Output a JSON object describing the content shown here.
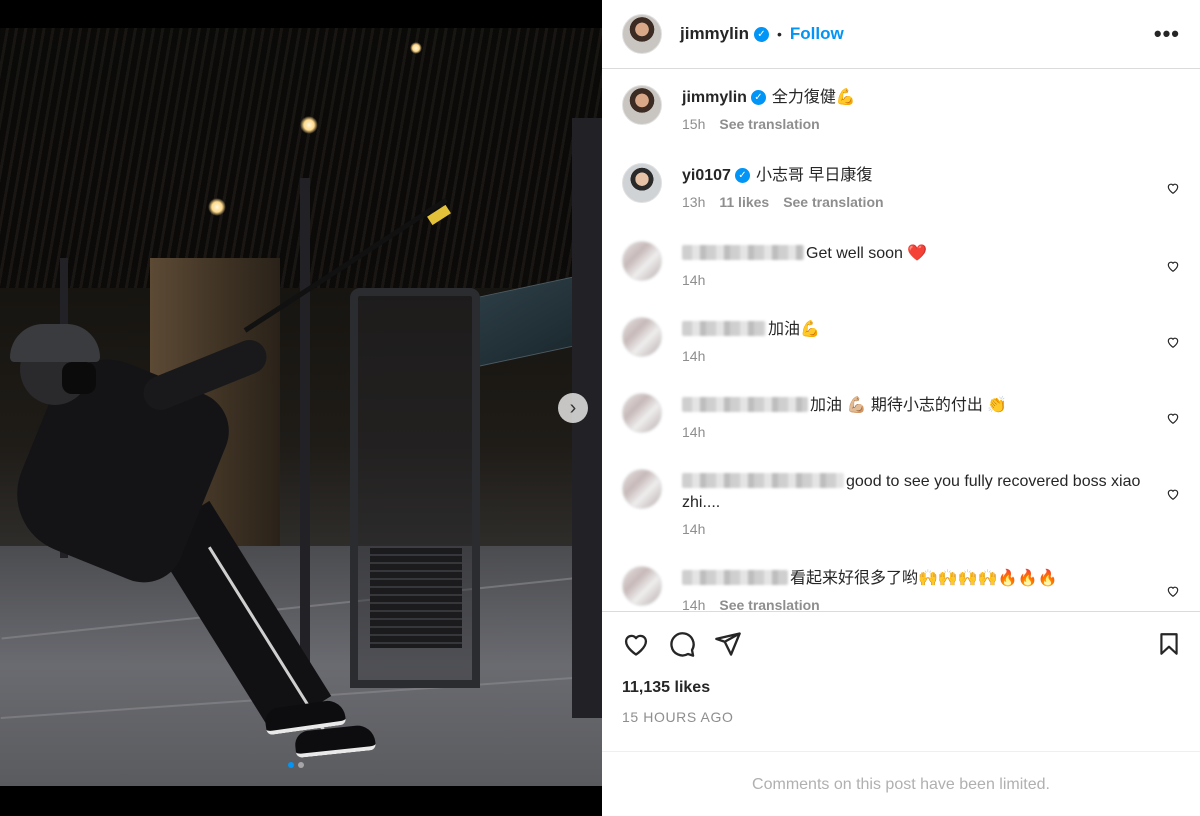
{
  "header": {
    "username": "jimmylin",
    "separator": "•",
    "follow_label": "Follow",
    "more_label": "•••"
  },
  "caption": {
    "username": "jimmylin",
    "text": "全力復健💪",
    "time": "15h",
    "translate": "See translation"
  },
  "comments": [
    {
      "username": "yi0107",
      "verified": true,
      "text": "小志哥 早日康復",
      "time": "13h",
      "likes": "11 likes",
      "translate": "See translation"
    },
    {
      "username_blurred": true,
      "text": "Get well soon ❤️",
      "time": "14h"
    },
    {
      "username_blurred": true,
      "text": "加油💪",
      "time": "14h"
    },
    {
      "username_blurred": true,
      "text": "加油 💪🏼 期待小志的付出 👏",
      "time": "14h"
    },
    {
      "username_blurred": true,
      "text": "good to see you fully recovered boss xiao zhi....",
      "time": "14h"
    },
    {
      "username_blurred": true,
      "text": "看起来好很多了哟🙌🙌🙌🙌🔥🔥🔥",
      "time": "14h",
      "translate": "See translation"
    }
  ],
  "stats": {
    "likes": "11,135 likes",
    "time_ago": "15 HOURS AGO"
  },
  "footer": {
    "limited": "Comments on this post have been limited."
  },
  "colors": {
    "accent": "#0095f6",
    "text": "#262626",
    "muted": "#8e8e8e",
    "border": "#dbdbdb"
  },
  "carousel": {
    "next_icon": "chevron-right-icon",
    "next_glyph": "›",
    "slide_count": 2,
    "active_slide": 1
  }
}
